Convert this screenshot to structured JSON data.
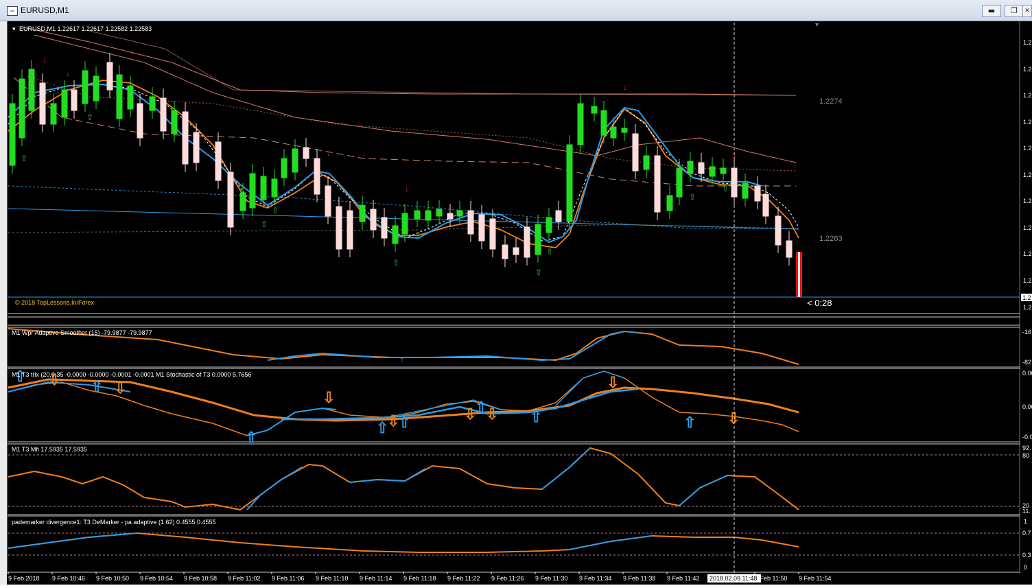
{
  "window": {
    "title": "EURUSD,M1",
    "app_icon": "chart-window-icon",
    "buttons": [
      {
        "name": "minimize-button",
        "glyph": "▬"
      },
      {
        "name": "restore-button",
        "glyph": "❐"
      },
      {
        "name": "close-button",
        "glyph": "✕"
      }
    ]
  },
  "main_panel": {
    "header": "EURUSD,M1  1.22617 1.22617 1.22582 1.22583",
    "price_label_upper": "1.2274",
    "price_label_lower": "1.2263",
    "countdown": "< 0:28",
    "copyright": "© 2018 TopLessons.In/Forex",
    "price_axis_labels": [
      "1.2",
      "1.2",
      "1.2",
      "1.2",
      "1.2",
      "1.2",
      "1.2",
      "1.2",
      "1.2",
      "1.2",
      "1.2"
    ],
    "current_price_tag": "1.2",
    "bottom_axis_label": "1.2"
  },
  "panels": [
    {
      "header": "M1  Wpr Adaptive Smoother (15) -79.9877 -79.9877",
      "axis_top": "-16",
      "axis_bottom": "-82"
    },
    {
      "header": "M1  T3 trix (20,0.35 -0.0000 -0.0000 -0.0001 -0.0001  M1   Stochastic of T3 0.0000 5.7656",
      "axis_top": "0.00",
      "axis_mid": "0.00",
      "axis_bottom": "-0.0"
    },
    {
      "header": "M1  T3 Mfi  17.5935 17.5935",
      "axis_top": "92.",
      "axis_80": "80",
      "axis_20": "20",
      "axis_bottom": "11."
    },
    {
      "header": "pademarker divergence1: T3 DeMarker - pa adaptive (1.62) 0.4555 0.4555",
      "axis_top": "1",
      "axis_07": "0.7",
      "axis_03": "0.3",
      "axis_bottom": "0"
    }
  ],
  "time_axis": {
    "labels": [
      "9 Feb 2018",
      "9 Feb 10:46",
      "9 Feb 10:50",
      "9 Feb 10:54",
      "9 Feb 10:58",
      "9 Feb 11:02",
      "9 Feb 11:06",
      "9 Feb 11:10",
      "9 Feb 11:14",
      "9 Feb 11:18",
      "9 Feb 11:22",
      "9 Feb 11:26",
      "9 Feb 11:30",
      "9 Feb 11:34",
      "9 Feb 11:38",
      "9 Feb 11:42",
      "9 Feb 11:46",
      "9 Feb 11:50",
      "9 Feb 11:54"
    ],
    "crosshair_label": "2018.02.09 11:48"
  },
  "colors": {
    "background": "#000000",
    "bull": "#22dd22",
    "bear": "#ffdcdc",
    "blue": "#2b9be8",
    "orange": "#f07f1a",
    "salmon": "#d87868",
    "up_arrow": "#22cc44",
    "down_arrow": "#ee2222"
  }
}
